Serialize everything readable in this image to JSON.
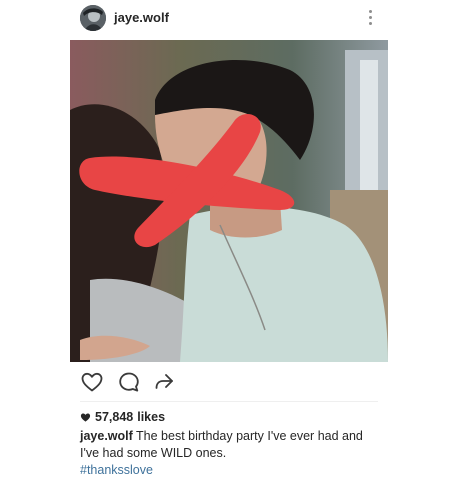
{
  "post": {
    "username": "jaye.wolf",
    "likes_count": "57,848",
    "likes_suffix": "likes",
    "caption_text": "The best birthday party I've ever had and I've had some WILD ones.",
    "hashtag": "#thanksslove"
  },
  "icons": {
    "avatar": "profile-avatar",
    "more": "more-vertical-icon",
    "like": "heart-icon",
    "comment": "comment-icon",
    "share": "share-arrow-icon",
    "likes_heart": "heart-filled-icon"
  },
  "colors": {
    "text": "#262626",
    "hashtag": "#3f729b",
    "redaction": "#e84545"
  }
}
